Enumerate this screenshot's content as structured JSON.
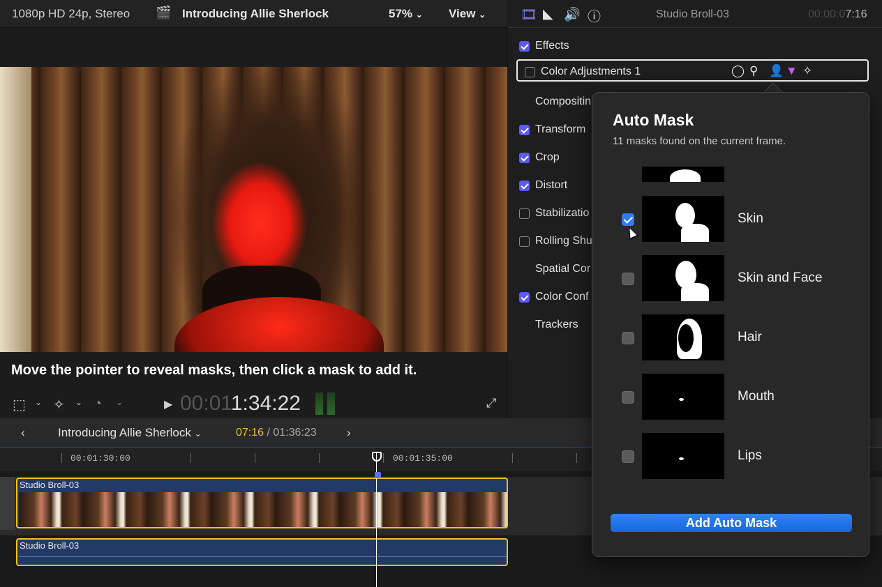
{
  "viewer": {
    "format": "1080p HD 24p, Stereo",
    "project_title": "Introducing Allie Sherlock",
    "zoom": "57%",
    "view_menu": "View",
    "hint": "Move the pointer to reveal masks, then click a mask to add it.",
    "timecode_dim": "00:01",
    "timecode_lit": "1:34:22"
  },
  "inspector": {
    "clip_name": "Studio Broll-03",
    "timecode_dim": "00:00:0",
    "timecode_lit": "7:16",
    "effects_label": "Effects",
    "color_adjustments_label": "Color Adjustments 1",
    "rows": [
      {
        "label": "Compositin",
        "checked": null
      },
      {
        "label": "Transform",
        "checked": true
      },
      {
        "label": "Crop",
        "checked": true
      },
      {
        "label": "Distort",
        "checked": true
      },
      {
        "label": "Stabilizatio",
        "checked": false
      },
      {
        "label": "Rolling Shu",
        "checked": false
      },
      {
        "label": "Spatial Cor",
        "checked": null
      },
      {
        "label": "Color Conf",
        "checked": true
      },
      {
        "label": "Trackers",
        "checked": null
      }
    ]
  },
  "timeline": {
    "project": "Introducing Allie Sherlock",
    "current": "07:16",
    "separator": " / ",
    "total": "01:36:23",
    "ruler_labels": [
      "00:01:30:00",
      "00:01:35:00"
    ],
    "clip_top": "Studio Broll-03",
    "clip_bottom": "Studio Broll-03"
  },
  "auto_mask": {
    "title": "Auto Mask",
    "subtitle": "11 masks found on the current frame.",
    "masks": [
      {
        "label": "Skin",
        "checked": true
      },
      {
        "label": "Skin and Face",
        "checked": false
      },
      {
        "label": "Hair",
        "checked": false
      },
      {
        "label": "Mouth",
        "checked": false
      },
      {
        "label": "Lips",
        "checked": false
      }
    ],
    "button": "Add Auto Mask"
  },
  "colors": {
    "accent_checkbox": "#5b5bf1",
    "clip_selection": "#f2c318",
    "button_blue": "#1f77ee",
    "timecode_yellow": "#e6c02a"
  }
}
